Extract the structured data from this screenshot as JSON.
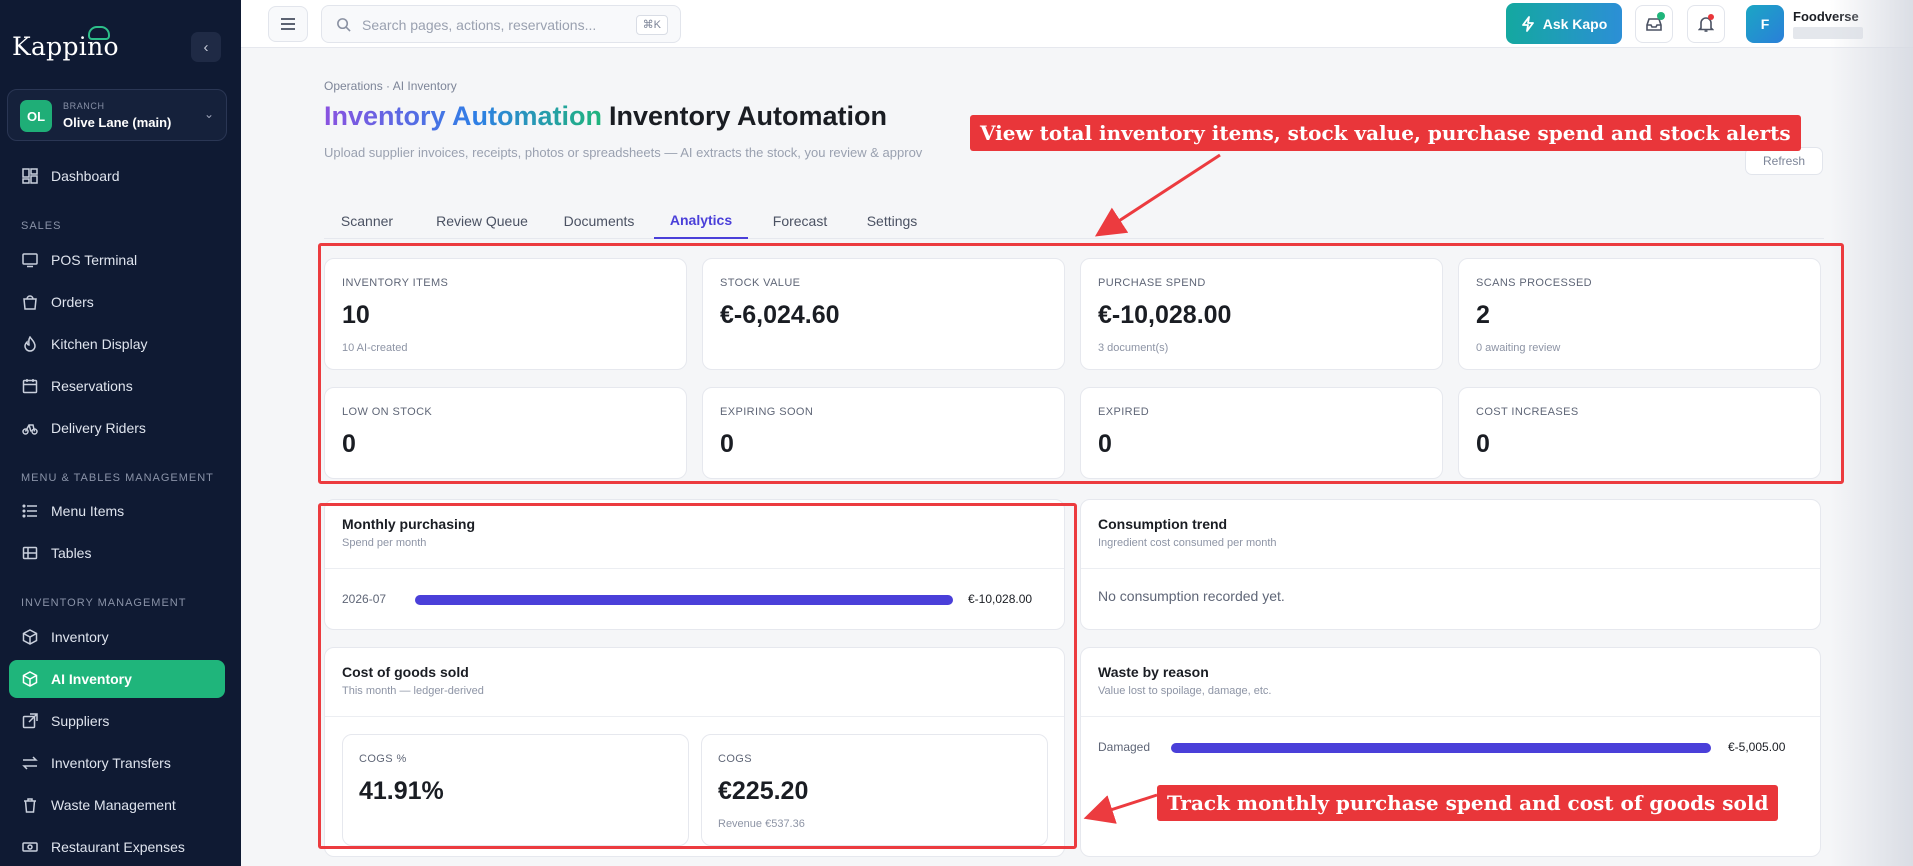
{
  "sidebar": {
    "logo": "Kappino",
    "branch": {
      "caption": "BRANCH",
      "initials": "OL",
      "name": "Olive Lane (main)"
    },
    "nav": {
      "dashboard": "Dashboard",
      "sales_section": "SALES",
      "pos": "POS Terminal",
      "orders": "Orders",
      "kitchen": "Kitchen Display",
      "reservations": "Reservations",
      "riders": "Delivery Riders",
      "menu_section": "MENU & TABLES MANAGEMENT",
      "menu_items": "Menu Items",
      "tables": "Tables",
      "inventory_section": "INVENTORY MANAGEMENT",
      "inventory": "Inventory",
      "ai_inventory": "AI Inventory",
      "suppliers": "Suppliers",
      "transfers": "Inventory Transfers",
      "waste": "Waste Management",
      "expenses": "Restaurant Expenses"
    }
  },
  "topbar": {
    "search_placeholder": "Search pages, actions, reservations...",
    "search_shortcut": "⌘K",
    "ask_label": "Ask Kapo",
    "user_initial": "F",
    "user_name": "Foodverse"
  },
  "page": {
    "breadcrumb": "Operations · AI Inventory",
    "title_gradient": "Inventory Automation",
    "title": "Inventory Automation",
    "subtitle": "Upload supplier invoices, receipts, photos or spreadsheets — AI extracts the stock, you review & approv",
    "refresh": "Refresh"
  },
  "tabs": [
    "Scanner",
    "Review Queue",
    "Documents",
    "Analytics",
    "Forecast",
    "Settings"
  ],
  "stats": [
    {
      "label": "INVENTORY ITEMS",
      "value": "10",
      "sub": "10 AI-created"
    },
    {
      "label": "STOCK VALUE",
      "value": "€-6,024.60",
      "sub": ""
    },
    {
      "label": "PURCHASE SPEND",
      "value": "€-10,028.00",
      "sub": "3 document(s)"
    },
    {
      "label": "SCANS PROCESSED",
      "value": "2",
      "sub": "0 awaiting review"
    },
    {
      "label": "LOW ON STOCK",
      "value": "0",
      "sub": ""
    },
    {
      "label": "EXPIRING SOON",
      "value": "0",
      "sub": ""
    },
    {
      "label": "EXPIRED",
      "value": "0",
      "sub": ""
    },
    {
      "label": "COST INCREASES",
      "value": "0",
      "sub": ""
    }
  ],
  "monthly": {
    "title": "Monthly purchasing",
    "subtitle": "Spend per month",
    "rows": [
      {
        "label": "2026-07",
        "value": "€-10,028.00",
        "fraction": 1.0
      }
    ]
  },
  "consumption": {
    "title": "Consumption trend",
    "subtitle": "Ingredient cost consumed per month",
    "empty": "No consumption recorded yet."
  },
  "cogs": {
    "title": "Cost of goods sold",
    "subtitle": "This month — ledger-derived",
    "percent_label": "COGS %",
    "percent_value": "41.91%",
    "amount_label": "COGS",
    "amount_value": "€225.20",
    "revenue_note": "Revenue €537.36"
  },
  "waste": {
    "title": "Waste by reason",
    "subtitle": "Value lost to spoilage, damage, etc.",
    "rows": [
      {
        "label": "Damaged",
        "value": "€-5,005.00",
        "fraction": 1.0
      }
    ]
  },
  "annotations": {
    "top": "View total inventory items, stock value, purchase spend and stock alerts",
    "bottom": "Track monthly purchase spend and cost of goods sold"
  },
  "colors": {
    "accent": "#4a3fd9",
    "brand": "#1fb57b",
    "sidebar": "#0f1a33",
    "annotation": "#e9363a"
  }
}
